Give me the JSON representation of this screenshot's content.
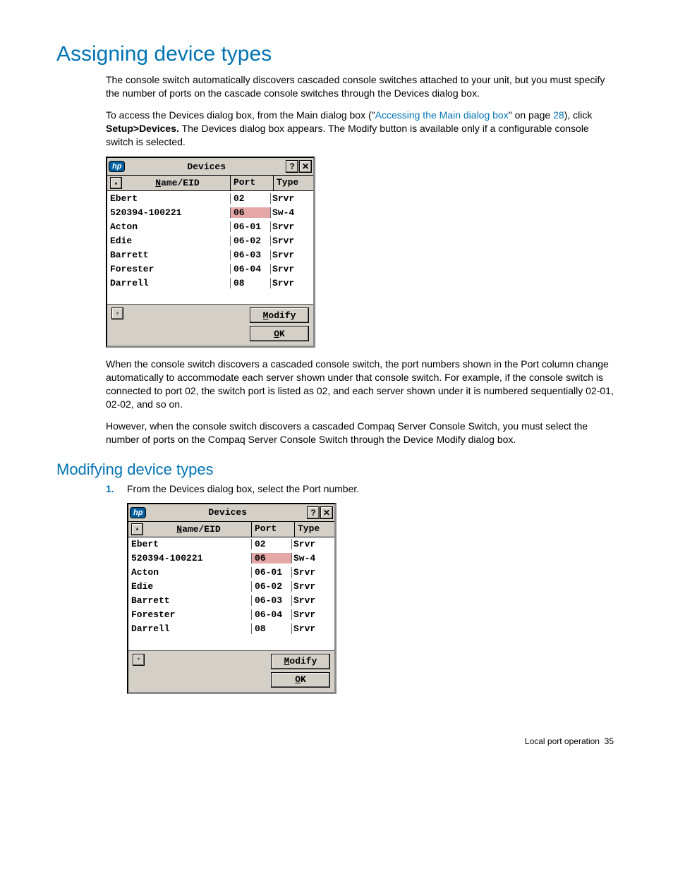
{
  "h1": "Assigning device types",
  "p1a": "The console switch automatically discovers cascaded console switches attached to your unit, but you must specify the number of ports on the cascade console switches through the Devices dialog box.",
  "p2_pre": "To access the Devices dialog box, from the Main dialog box (\"",
  "p2_link": "Accessing the Main dialog box",
  "p2_mid": "\" on page ",
  "p2_page": "28",
  "p2_after": "), click ",
  "p2_bold": "Setup>Devices.",
  "p2_end": " The Devices dialog box appears. The Modify button is available only if a configurable console switch is selected.",
  "p3": "When the console switch discovers a cascaded console switch, the port numbers shown in the Port column change automatically to accommodate each server shown under that console switch. For example, if the console switch is connected to port 02, the switch port is listed as 02, and each server shown under it is numbered sequentially 02-01, 02-02, and so on.",
  "p4": "However, when the console switch discovers a cascaded Compaq Server Console Switch, you must select the number of ports on the Compaq Server Console Switch through the Device Modify dialog box.",
  "h2": "Modifying device types",
  "step1_num": "1.",
  "step1_txt": "From the Devices dialog box, select the Port number.",
  "dialog": {
    "logo": "hp",
    "title": "Devices",
    "help": "?",
    "close": "✕",
    "hdr_name_u": "N",
    "hdr_name_rest": "ame/EID",
    "hdr_port": "Port",
    "hdr_type": "Type",
    "rows": [
      {
        "name": "Ebert",
        "port": "02",
        "type": "Srvr",
        "hl": false
      },
      {
        "name": "520394-100221",
        "port": "06",
        "type": "Sw-4",
        "hl": true
      },
      {
        "name": "Acton",
        "port": "06-01",
        "type": "Srvr",
        "hl": false
      },
      {
        "name": "Edie",
        "port": "06-02",
        "type": "Srvr",
        "hl": false
      },
      {
        "name": "Barrett",
        "port": "06-03",
        "type": "Srvr",
        "hl": false
      },
      {
        "name": "Forester",
        "port": "06-04",
        "type": "Srvr",
        "hl": false
      },
      {
        "name": "Darrell",
        "port": "08",
        "type": "Srvr",
        "hl": false
      }
    ],
    "btn_modify_u": "M",
    "btn_modify_rest": "odify",
    "btn_ok_u": "O",
    "btn_ok_rest": "K"
  },
  "footer_text": "Local port operation",
  "footer_page": "35"
}
